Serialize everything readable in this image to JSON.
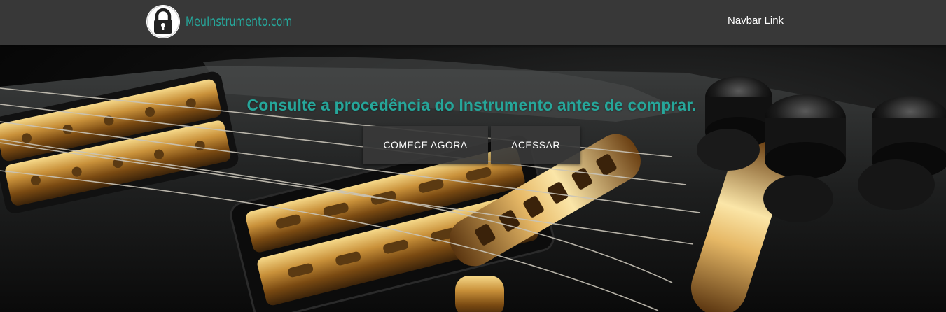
{
  "navbar": {
    "brand_name": "MeuInstrumento.com",
    "brand_icon": "padlock-icon",
    "link_label": "Navbar Link"
  },
  "hero": {
    "title": "Consulte a procedência do Instrumento antes de comprar.",
    "background": "electric-guitar-photo",
    "buttons": {
      "start_label": "COMECE AGORA",
      "login_label": "ACESSAR"
    }
  },
  "colors": {
    "navbar_bg": "#383838",
    "accent": "#26a69a",
    "button_bg": "#383838",
    "button_text": "#ffffff"
  }
}
